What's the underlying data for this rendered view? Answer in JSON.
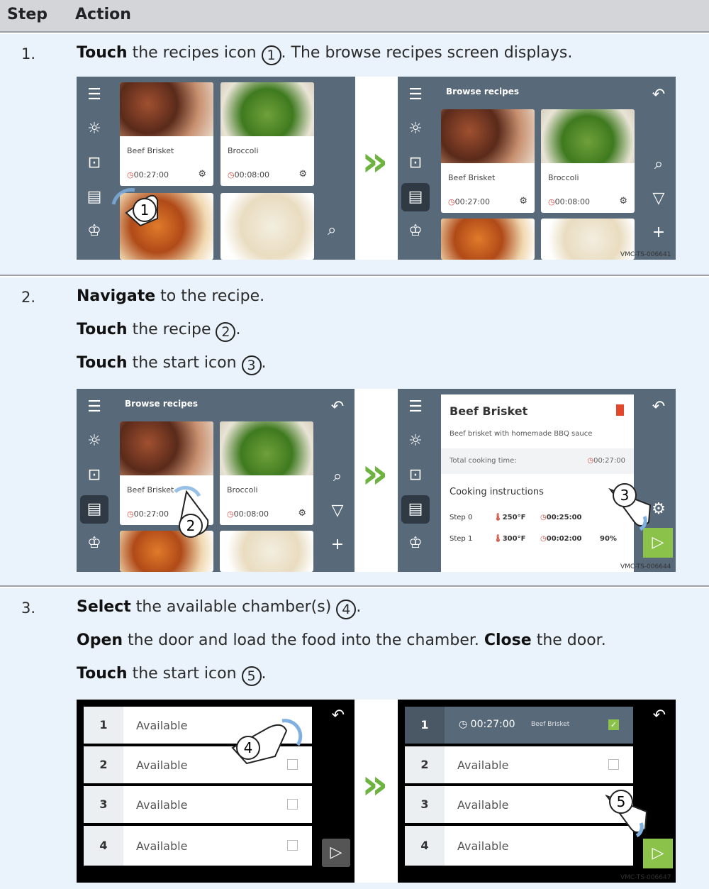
{
  "header": {
    "step": "Step",
    "action": "Action"
  },
  "steps": [
    {
      "num": "1.",
      "lines": [
        {
          "b": "Touch",
          "t": " the recipes icon ",
          "c": "1",
          "a": ". The browse recipes screen displays."
        }
      ]
    },
    {
      "num": "2.",
      "lines": [
        {
          "b": "Navigate",
          "t": " to the recipe.",
          "c": "",
          "a": ""
        },
        {
          "b": "Touch",
          "t": " the recipe ",
          "c": "2",
          "a": "."
        },
        {
          "b": "Touch",
          "t": " the start icon ",
          "c": "3",
          "a": "."
        }
      ]
    },
    {
      "num": "3.",
      "lines": [
        {
          "b": "Select",
          "t": " the available chamber(s) ",
          "c": "4",
          "a": "."
        },
        {
          "b": "Open",
          "t": " the door and load the food into the chamber. ",
          "c": "",
          "a": "",
          "b2": "Close",
          "t2": " the door."
        },
        {
          "b": "Touch",
          "t": " the start icon ",
          "c": "5",
          "a": "."
        }
      ]
    }
  ],
  "ui": {
    "browse_title": "Browse recipes",
    "recipes": [
      {
        "name": "Beef Brisket",
        "time": "00:27:00"
      },
      {
        "name": "Broccoli",
        "time": "00:08:00"
      }
    ],
    "detail": {
      "title": "Beef Brisket",
      "subtitle": "Beef brisket with homemade BBQ sauce",
      "total_label": "Total cooking time:",
      "total": "00:27:00",
      "instr": "Cooking instructions",
      "steps": [
        {
          "name": "Step 0",
          "temp": "250°F",
          "time": "00:25:00",
          "hum": ""
        },
        {
          "name": "Step 1",
          "temp": "300°F",
          "time": "00:02:00",
          "hum": "90%"
        }
      ]
    },
    "chambers": [
      {
        "n": "1",
        "label": "Available"
      },
      {
        "n": "2",
        "label": "Available"
      },
      {
        "n": "3",
        "label": "Available"
      },
      {
        "n": "4",
        "label": "Available"
      }
    ],
    "chamber1_active": {
      "time": "00:27:00",
      "name": "Beef Brisket"
    },
    "refs": [
      "VMC-TS-006641",
      "VMC-TS-006644",
      "VMC-TS-006647"
    ]
  },
  "colors": {
    "row_bg": "#eaf2fb",
    "screen": "#58697a",
    "accent": "#6db33f"
  }
}
